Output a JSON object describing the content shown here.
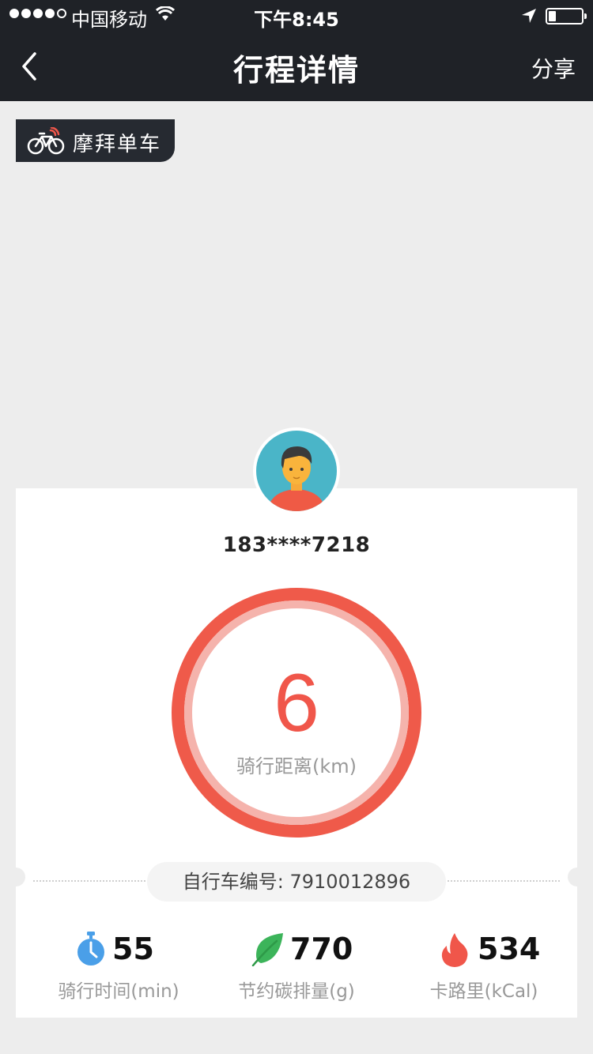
{
  "status_bar": {
    "carrier": "中国移动",
    "time": "下午8:45"
  },
  "nav": {
    "title": "行程详情",
    "share_label": "分享"
  },
  "brand": {
    "name": "摩拜单车"
  },
  "user": {
    "phone": "183****7218"
  },
  "ride": {
    "distance": "6",
    "distance_label": "骑行距离(km)",
    "bike_id_label": "自行车编号: 7910012896"
  },
  "stats": [
    {
      "icon": "stopwatch-icon",
      "value": "55",
      "label": "骑行时间(min)",
      "color": "#4a9fe8"
    },
    {
      "icon": "leaf-icon",
      "value": "770",
      "label": "节约碳排量(g)",
      "color": "#3cb45a"
    },
    {
      "icon": "flame-icon",
      "value": "534",
      "label": "卡路里(kCal)",
      "color": "#f0564a"
    }
  ],
  "colors": {
    "accent": "#f0564a",
    "header": "#1f2227",
    "background": "#ededed"
  }
}
